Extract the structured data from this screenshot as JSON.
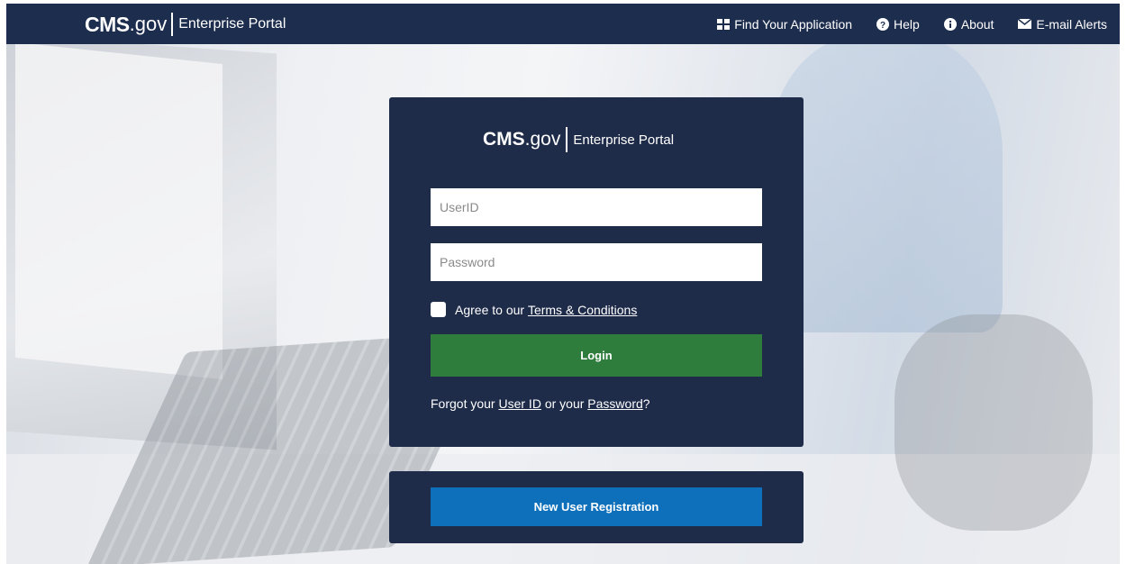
{
  "header": {
    "brand_bold": "CMS",
    "brand_suffix": ".gov",
    "brand_portal": "Enterprise Portal",
    "nav": [
      {
        "label": "Find Your Application",
        "icon": "grid-icon"
      },
      {
        "label": "Help",
        "icon": "question-circle-icon"
      },
      {
        "label": "About",
        "icon": "info-circle-icon"
      },
      {
        "label": "E-mail Alerts",
        "icon": "envelope-icon"
      }
    ]
  },
  "login": {
    "brand_bold": "CMS",
    "brand_suffix": ".gov",
    "brand_portal": "Enterprise Portal",
    "userid_placeholder": "UserID",
    "password_placeholder": "Password",
    "terms_prefix": "Agree to our ",
    "terms_link": "Terms & Conditions",
    "login_label": "Login",
    "forgot_prefix": "Forgot your ",
    "forgot_userid": "User ID",
    "forgot_mid": " or your ",
    "forgot_password": "Password",
    "forgot_suffix": "?"
  },
  "registration": {
    "button_label": "New User Registration"
  },
  "colors": {
    "navy": "#1e2b49",
    "login_green": "#2e7d3d",
    "register_blue": "#0e6fba"
  }
}
